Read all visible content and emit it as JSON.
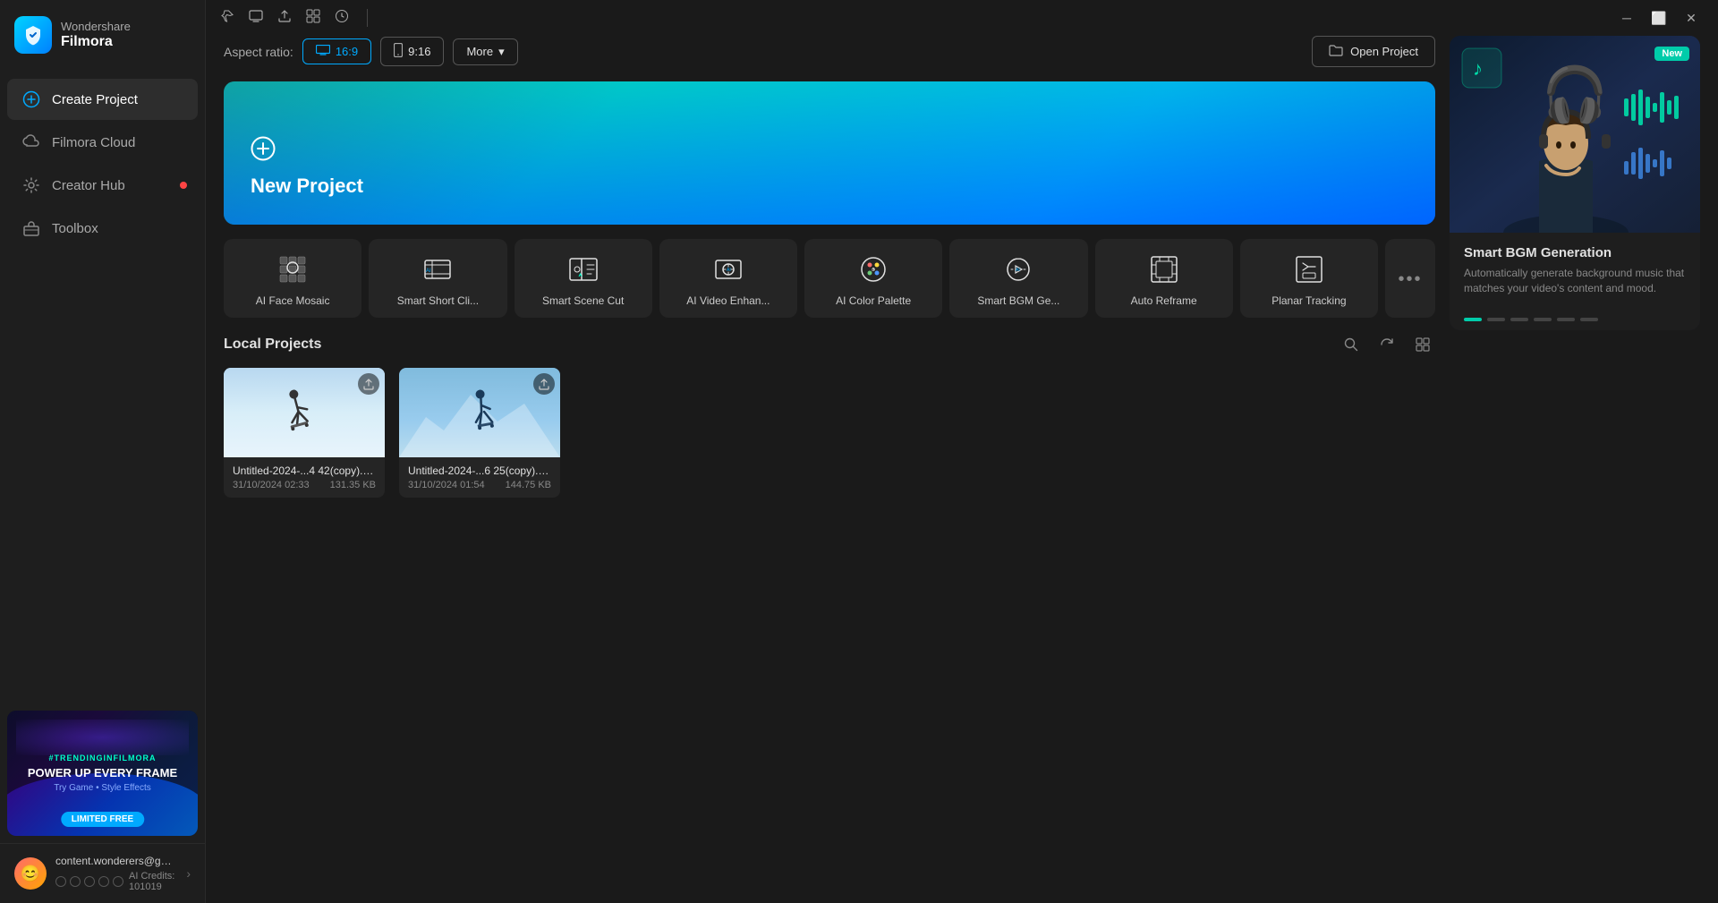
{
  "app": {
    "brand": "Wondershare",
    "product": "Filmora"
  },
  "titlebar": {
    "icons": [
      "pin",
      "screen",
      "upload",
      "grid",
      "headphone"
    ],
    "buttons": [
      "minimize",
      "maximize",
      "close"
    ]
  },
  "sidebar": {
    "nav_items": [
      {
        "id": "create-project",
        "label": "Create Project",
        "icon": "plus-circle",
        "active": true
      },
      {
        "id": "filmora-cloud",
        "label": "Filmora Cloud",
        "icon": "cloud"
      },
      {
        "id": "creator-hub",
        "label": "Creator Hub",
        "icon": "lightbulb",
        "badge": true
      },
      {
        "id": "toolbox",
        "label": "Toolbox",
        "icon": "toolbox"
      }
    ],
    "banner": {
      "tag": "#TRENDINGINFILMORA",
      "title": "POWER UP EVERY FRAME",
      "subtitle": "Try Game • Style Effects",
      "badge": "LIMITED FREE"
    },
    "user": {
      "email": "content.wonderers@gmail....",
      "credits_label": "AI Credits: 101019",
      "credits_count": 5
    }
  },
  "aspect_ratio": {
    "label": "Aspect ratio:",
    "options": [
      {
        "id": "16-9",
        "label": "16:9",
        "icon": "monitor",
        "active": true
      },
      {
        "id": "9-16",
        "label": "9:16",
        "icon": "phone"
      }
    ],
    "more_label": "More",
    "open_project_label": "Open Project"
  },
  "new_project": {
    "title": "New Project",
    "icon": "plus-circle"
  },
  "ai_tools": [
    {
      "id": "ai-face-mosaic",
      "label": "AI Face Mosaic",
      "icon": "👤"
    },
    {
      "id": "smart-short-cli",
      "label": "Smart Short Cli...",
      "icon": "✂️"
    },
    {
      "id": "smart-scene-cut",
      "label": "Smart Scene Cut",
      "icon": "🎬"
    },
    {
      "id": "ai-video-enhan",
      "label": "AI Video Enhan...",
      "icon": "✨"
    },
    {
      "id": "ai-color-palette",
      "label": "AI Color Palette",
      "icon": "🎨"
    },
    {
      "id": "smart-bgm-ge",
      "label": "Smart BGM Ge...",
      "icon": "🎵"
    },
    {
      "id": "auto-reframe",
      "label": "Auto Reframe",
      "icon": "⬛"
    },
    {
      "id": "planar-tracking",
      "label": "Planar Tracking",
      "icon": "🔲"
    }
  ],
  "more_tools_label": "•••",
  "local_projects": {
    "title": "Local Projects",
    "projects": [
      {
        "id": "project-1",
        "name": "Untitled-2024-...4 42(copy).wfp",
        "date": "31/10/2024 02:33",
        "size": "131.35 KB",
        "thumb_type": "snow"
      },
      {
        "id": "project-2",
        "name": "Untitled-2024-...6 25(copy).wfp",
        "date": "31/10/2024 01:54",
        "size": "144.75 KB",
        "thumb_type": "sky"
      }
    ]
  },
  "promo": {
    "badge": "New",
    "title": "Smart BGM Generation",
    "description": "Automatically generate background music that matches your video's content and mood.",
    "dots_count": 6,
    "active_dot": 0
  }
}
